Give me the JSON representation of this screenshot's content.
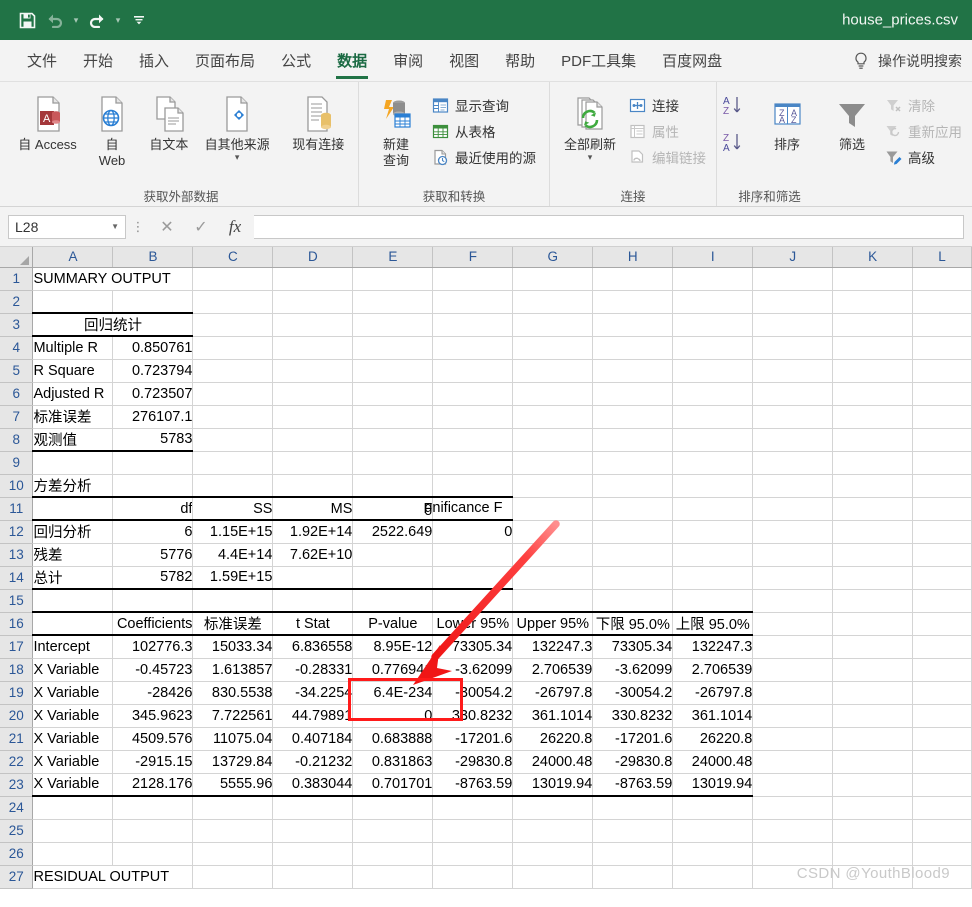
{
  "window": {
    "doc_title": "house_prices.csv",
    "accent_color": "#217346",
    "quick_access": [
      {
        "name": "save-icon",
        "label": "保存"
      },
      {
        "name": "undo-icon",
        "label": "撤销"
      },
      {
        "name": "redo-icon",
        "label": "恢复"
      },
      {
        "name": "customize-qat-icon",
        "label": "自定义快速访问工具栏"
      }
    ]
  },
  "tabs": [
    {
      "label": "文件",
      "active": false
    },
    {
      "label": "开始",
      "active": false
    },
    {
      "label": "插入",
      "active": false
    },
    {
      "label": "页面布局",
      "active": false
    },
    {
      "label": "公式",
      "active": false
    },
    {
      "label": "数据",
      "active": true
    },
    {
      "label": "审阅",
      "active": false
    },
    {
      "label": "视图",
      "active": false
    },
    {
      "label": "帮助",
      "active": false
    },
    {
      "label": "PDF工具集",
      "active": false
    },
    {
      "label": "百度网盘",
      "active": false
    }
  ],
  "tell_me": {
    "label": "操作说明搜索",
    "icon": "lightbulb-icon"
  },
  "ribbon": {
    "groups": [
      {
        "name": "get-external-data",
        "label": "获取外部数据",
        "big_buttons": [
          {
            "label": "自 Access",
            "icon": "access-db-icon",
            "caret": false
          },
          {
            "label": "自\nWeb",
            "icon": "web-page-icon",
            "caret": false
          },
          {
            "label": "自文本",
            "icon": "text-file-icon",
            "caret": false
          },
          {
            "label": "自其他来源",
            "icon": "other-sources-icon",
            "caret": true
          },
          {
            "label": "现有连接",
            "icon": "existing-connections-icon",
            "caret": false
          }
        ]
      },
      {
        "name": "get-and-transform",
        "label": "获取和转换",
        "big_buttons": [
          {
            "label": "新建\n查询",
            "icon": "new-query-icon",
            "caret": true
          }
        ],
        "small_buttons": [
          {
            "label": "显示查询",
            "icon": "show-queries-icon",
            "disabled": false
          },
          {
            "label": "从表格",
            "icon": "from-table-icon",
            "disabled": false
          },
          {
            "label": "最近使用的源",
            "icon": "recent-sources-icon",
            "disabled": false
          }
        ]
      },
      {
        "name": "connections",
        "label": "连接",
        "big_buttons": [
          {
            "label": "全部刷新",
            "icon": "refresh-all-icon",
            "caret": true
          }
        ],
        "small_buttons": [
          {
            "label": "连接",
            "icon": "connections-icon",
            "disabled": false
          },
          {
            "label": "属性",
            "icon": "properties-icon",
            "disabled": true
          },
          {
            "label": "编辑链接",
            "icon": "edit-links-icon",
            "disabled": true
          }
        ]
      },
      {
        "name": "sort-and-filter",
        "label": "排序和筛选",
        "sort_small": [
          {
            "label": "",
            "icon": "sort-az-icon"
          },
          {
            "label": "",
            "icon": "sort-za-icon"
          }
        ],
        "big_buttons": [
          {
            "label": "排序",
            "icon": "sort-dialog-icon",
            "caret": false
          },
          {
            "label": "筛选",
            "icon": "filter-icon",
            "caret": false
          }
        ],
        "small_buttons": [
          {
            "label": "清除",
            "icon": "clear-filter-icon",
            "disabled": true
          },
          {
            "label": "重新应用",
            "icon": "reapply-icon",
            "disabled": true
          },
          {
            "label": "高级",
            "icon": "advanced-filter-icon",
            "disabled": false
          }
        ]
      }
    ]
  },
  "formula_bar": {
    "name_box_value": "L28",
    "cancel_icon": "cancel-icon",
    "accept_icon": "accept-icon",
    "fx_icon": "insert-function-icon",
    "formula_value": ""
  },
  "sheet": {
    "columns": [
      "A",
      "B",
      "C",
      "D",
      "E",
      "F",
      "G",
      "H",
      "I",
      "J",
      "K",
      "L"
    ],
    "row_numbers": [
      1,
      2,
      3,
      4,
      5,
      6,
      7,
      8,
      9,
      10,
      11,
      12,
      13,
      14,
      15,
      16,
      17,
      18,
      19,
      20,
      21,
      22,
      23,
      24,
      25,
      26,
      27
    ],
    "rows": {
      "1": [
        "SUMMARY OUTPUT",
        "",
        "",
        "",
        "",
        "",
        "",
        "",
        "",
        "",
        "",
        ""
      ],
      "2": [
        "",
        "",
        "",
        "",
        "",
        "",
        "",
        "",
        "",
        "",
        "",
        ""
      ],
      "3": [
        "回归统计",
        "",
        "",
        "",
        "",
        "",
        "",
        "",
        "",
        "",
        "",
        ""
      ],
      "4": [
        "Multiple R",
        "0.850761",
        "",
        "",
        "",
        "",
        "",
        "",
        "",
        "",
        "",
        ""
      ],
      "5": [
        "R Square",
        "0.723794",
        "",
        "",
        "",
        "",
        "",
        "",
        "",
        "",
        "",
        ""
      ],
      "6": [
        "Adjusted R",
        "0.723507",
        "",
        "",
        "",
        "",
        "",
        "",
        "",
        "",
        "",
        ""
      ],
      "7": [
        "标准误差",
        "276107.1",
        "",
        "",
        "",
        "",
        "",
        "",
        "",
        "",
        "",
        ""
      ],
      "8": [
        "观测值",
        "5783",
        "",
        "",
        "",
        "",
        "",
        "",
        "",
        "",
        "",
        ""
      ],
      "9": [
        "",
        "",
        "",
        "",
        "",
        "",
        "",
        "",
        "",
        "",
        "",
        ""
      ],
      "10": [
        "方差分析",
        "",
        "",
        "",
        "",
        "",
        "",
        "",
        "",
        "",
        "",
        ""
      ],
      "11": [
        "",
        "df",
        "SS",
        "MS",
        "F",
        "gnificance F",
        "",
        "",
        "",
        "",
        "",
        ""
      ],
      "12": [
        "回归分析",
        "6",
        "1.15E+15",
        "1.92E+14",
        "2522.649",
        "0",
        "",
        "",
        "",
        "",
        "",
        ""
      ],
      "13": [
        "残差",
        "5776",
        "4.4E+14",
        "7.62E+10",
        "",
        "",
        "",
        "",
        "",
        "",
        "",
        ""
      ],
      "14": [
        "总计",
        "5782",
        "1.59E+15",
        "",
        "",
        "",
        "",
        "",
        "",
        "",
        "",
        ""
      ],
      "15": [
        "",
        "",
        "",
        "",
        "",
        "",
        "",
        "",
        "",
        "",
        "",
        ""
      ],
      "16": [
        "",
        "Coefficients",
        "标准误差",
        "t Stat",
        "P-value",
        "Lower 95%",
        "Upper 95%",
        "下限 95.0%",
        "上限 95.0%",
        "",
        "",
        ""
      ],
      "17": [
        "Intercept",
        "102776.3",
        "15033.34",
        "6.836558",
        "8.95E-12",
        "73305.34",
        "132247.3",
        "73305.34",
        "132247.3",
        "",
        "",
        ""
      ],
      "18": [
        "X Variable",
        "-0.45723",
        "1.613857",
        "-0.28331",
        "0.776941",
        "-3.62099",
        "2.706539",
        "-3.62099",
        "2.706539",
        "",
        "",
        ""
      ],
      "19": [
        "X Variable",
        "-28426",
        "830.5538",
        "-34.2254",
        "6.4E-234",
        "-30054.2",
        "-26797.8",
        "-30054.2",
        "-26797.8",
        "",
        "",
        ""
      ],
      "20": [
        "X Variable",
        "345.9623",
        "7.722561",
        "44.79891",
        "0",
        "330.8232",
        "361.1014",
        "330.8232",
        "361.1014",
        "",
        "",
        ""
      ],
      "21": [
        "X Variable",
        "4509.576",
        "11075.04",
        "0.407184",
        "0.683888",
        "-17201.6",
        "26220.8",
        "-17201.6",
        "26220.8",
        "",
        "",
        ""
      ],
      "22": [
        "X Variable",
        "-2915.15",
        "13729.84",
        "-0.21232",
        "0.831863",
        "-29830.8",
        "24000.48",
        "-29830.8",
        "24000.48",
        "",
        "",
        ""
      ],
      "23": [
        "X Variable",
        "2128.176",
        "5555.96",
        "0.383044",
        "0.701701",
        "-8763.59",
        "13019.94",
        "-8763.59",
        "13019.94",
        "",
        "",
        ""
      ],
      "24": [
        "",
        "",
        "",
        "",
        "",
        "",
        "",
        "",
        "",
        "",
        "",
        ""
      ],
      "25": [
        "",
        "",
        "",
        "",
        "",
        "",
        "",
        "",
        "",
        "",
        "",
        ""
      ],
      "26": [
        "",
        "",
        "",
        "",
        "",
        "",
        "",
        "",
        "",
        "",
        "",
        ""
      ],
      "27": [
        "RESIDUAL OUTPUT",
        "",
        "",
        "",
        "",
        "",
        "",
        "",
        "",
        "",
        "",
        ""
      ]
    }
  },
  "annotations": {
    "highlight_color": "#ff1a1a",
    "highlight_target_cell": "E20",
    "arrow_from": "F12 area",
    "arrow_to": "E18"
  },
  "watermark": {
    "text": "CSDN @YouthBlood9"
  }
}
